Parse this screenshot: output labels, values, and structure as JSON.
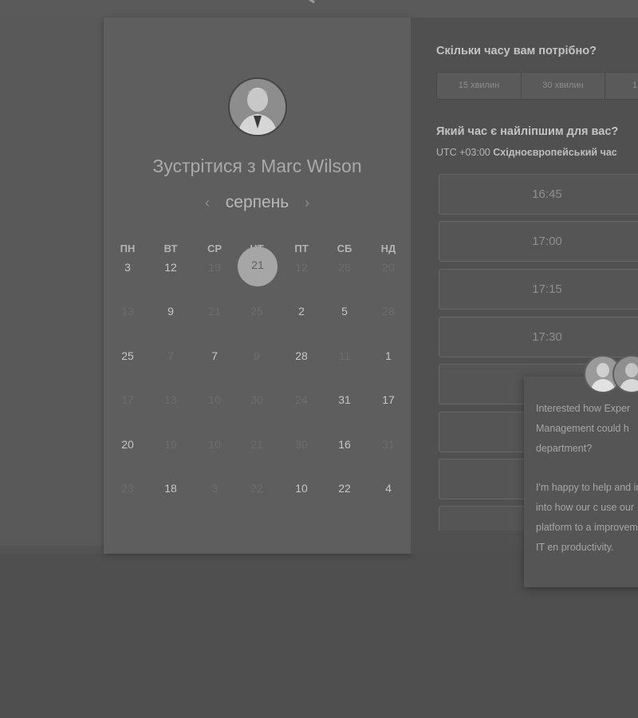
{
  "calendar": {
    "title": "Зустрітися з Marc Wilson",
    "month": "серпень",
    "prev_icon": "‹",
    "next_icon": "›",
    "weekdays": [
      "ПН",
      "ВТ",
      "СР",
      "ЧТ",
      "ПТ",
      "СБ",
      "НД"
    ],
    "weeks": [
      [
        {
          "t": "3",
          "d": false
        },
        {
          "t": "12",
          "d": false
        },
        {
          "t": "19",
          "d": true
        },
        {
          "t": "21",
          "d": false,
          "selected": true
        },
        {
          "t": "12",
          "d": true
        },
        {
          "t": "28",
          "d": true
        },
        {
          "t": "20",
          "d": true
        }
      ],
      [
        {
          "t": "13",
          "d": true
        },
        {
          "t": "9",
          "d": false
        },
        {
          "t": "21",
          "d": true
        },
        {
          "t": "25",
          "d": true
        },
        {
          "t": "2",
          "d": false
        },
        {
          "t": "5",
          "d": false
        },
        {
          "t": "28",
          "d": true
        }
      ],
      [
        {
          "t": "25",
          "d": false
        },
        {
          "t": "7",
          "d": true
        },
        {
          "t": "7",
          "d": false
        },
        {
          "t": "9",
          "d": true
        },
        {
          "t": "28",
          "d": false
        },
        {
          "t": "11",
          "d": true
        },
        {
          "t": "1",
          "d": false
        }
      ],
      [
        {
          "t": "17",
          "d": true
        },
        {
          "t": "13",
          "d": true
        },
        {
          "t": "10",
          "d": true
        },
        {
          "t": "30",
          "d": true
        },
        {
          "t": "24",
          "d": true
        },
        {
          "t": "31",
          "d": false
        },
        {
          "t": "17",
          "d": false
        }
      ],
      [
        {
          "t": "20",
          "d": false
        },
        {
          "t": "19",
          "d": true
        },
        {
          "t": "10",
          "d": true
        },
        {
          "t": "21",
          "d": true
        },
        {
          "t": "30",
          "d": true
        },
        {
          "t": "16",
          "d": false
        },
        {
          "t": "31",
          "d": true
        }
      ],
      [
        {
          "t": "23",
          "d": true
        },
        {
          "t": "18",
          "d": false
        },
        {
          "t": "3",
          "d": true
        },
        {
          "t": "22",
          "d": true
        },
        {
          "t": "10",
          "d": false
        },
        {
          "t": "22",
          "d": false
        },
        {
          "t": "4",
          "d": false
        }
      ]
    ]
  },
  "booking": {
    "duration_question": "Скільки часу вам потрібно?",
    "durations": [
      "15 хвилин",
      "30 хвилин",
      "1"
    ],
    "time_question": "Який час є найліпшим для вас?",
    "tz_offset": "UTC +03:00",
    "tz_name": "Східноєвропейський час",
    "slots": [
      "16:45",
      "17:00",
      "17:15",
      "17:30",
      "",
      "",
      ""
    ]
  },
  "chat": {
    "paragraph1": "Interested how Exper Management could h department?",
    "paragraph2": "I'm happy to help and insight into how our c use our platform to a improvement in IT en productivity."
  }
}
